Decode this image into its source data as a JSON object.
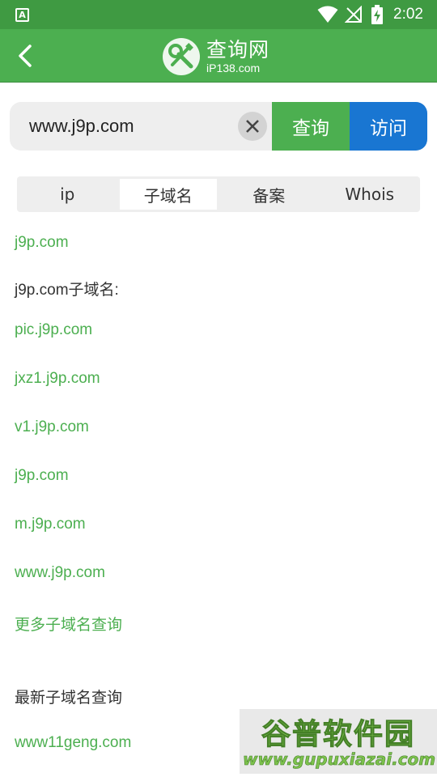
{
  "status_bar": {
    "left_icon_letter": "A",
    "time": "2:02"
  },
  "app_bar": {
    "title": "查询网",
    "subtitle": "iP138.com"
  },
  "search": {
    "value": "www.j9p.com",
    "query_label": "查询",
    "visit_label": "访问"
  },
  "tabs": [
    {
      "label": "ip",
      "active": false
    },
    {
      "label": "子域名",
      "active": true
    },
    {
      "label": "备案",
      "active": false
    },
    {
      "label": "Whois",
      "active": false
    }
  ],
  "content": {
    "domain": "j9p.com",
    "subdomain_heading": "j9p.com子域名:",
    "subdomains": [
      "pic.j9p.com",
      "jxz1.j9p.com",
      "v1.j9p.com",
      "j9p.com",
      "m.j9p.com",
      "www.j9p.com"
    ],
    "more_link": "更多子域名查询",
    "latest_heading": "最新子域名查询",
    "latest_items": [
      "www11geng.com"
    ]
  },
  "watermark": {
    "title": "谷普软件园",
    "url": "www.gupuxiazai.com"
  },
  "colors": {
    "status_bar": "#3f9a42",
    "app_bar": "#4caf50",
    "link": "#4caf50",
    "visit_button": "#1976d2"
  },
  "icons": {
    "back": "back-arrow-icon",
    "logo": "tools-icon",
    "clear": "close-icon",
    "wifi": "wifi-icon",
    "signal": "no-signal-icon",
    "battery": "battery-charging-icon"
  }
}
